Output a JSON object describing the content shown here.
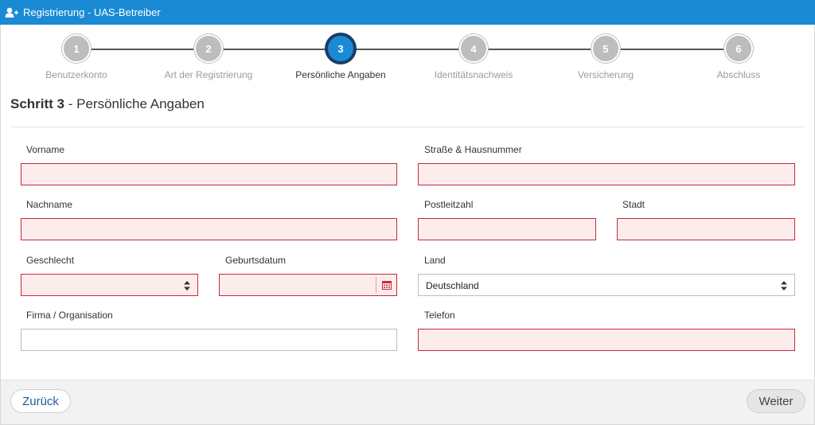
{
  "window": {
    "title": "Registrierung - UAS-Betreiber",
    "icon": "add-user-icon"
  },
  "stepper": {
    "steps": [
      {
        "number": "1",
        "label": "Benutzerkonto"
      },
      {
        "number": "2",
        "label": "Art der Registrierung"
      },
      {
        "number": "3",
        "label": "Persönliche Angaben"
      },
      {
        "number": "4",
        "label": "Identitätsnachweis"
      },
      {
        "number": "5",
        "label": "Versicherung"
      },
      {
        "number": "6",
        "label": "Abschluss"
      }
    ],
    "active_step": 3
  },
  "heading": {
    "step": "Schritt 3",
    "title": " - Persönliche Angaben"
  },
  "form": {
    "vorname": {
      "label": "Vorname",
      "value": ""
    },
    "nachname": {
      "label": "Nachname",
      "value": ""
    },
    "geschlecht": {
      "label": "Geschlecht",
      "value": ""
    },
    "geburtsdatum": {
      "label": "Geburtsdatum",
      "value": ""
    },
    "firma": {
      "label": "Firma / Organisation",
      "value": ""
    },
    "strasse": {
      "label": "Straße & Hausnummer",
      "value": ""
    },
    "plz": {
      "label": "Postleitzahl",
      "value": ""
    },
    "stadt": {
      "label": "Stadt",
      "value": ""
    },
    "land": {
      "label": "Land",
      "value": "Deutschland"
    },
    "telefon": {
      "label": "Telefon",
      "value": ""
    }
  },
  "footer": {
    "back_label": "Zurück",
    "next_label": "Weiter"
  },
  "colors": {
    "accent": "#1a8ad4",
    "invalid_border": "#c9283e",
    "invalid_fill": "#fdecec",
    "step_inactive": "#bdbdbd"
  }
}
